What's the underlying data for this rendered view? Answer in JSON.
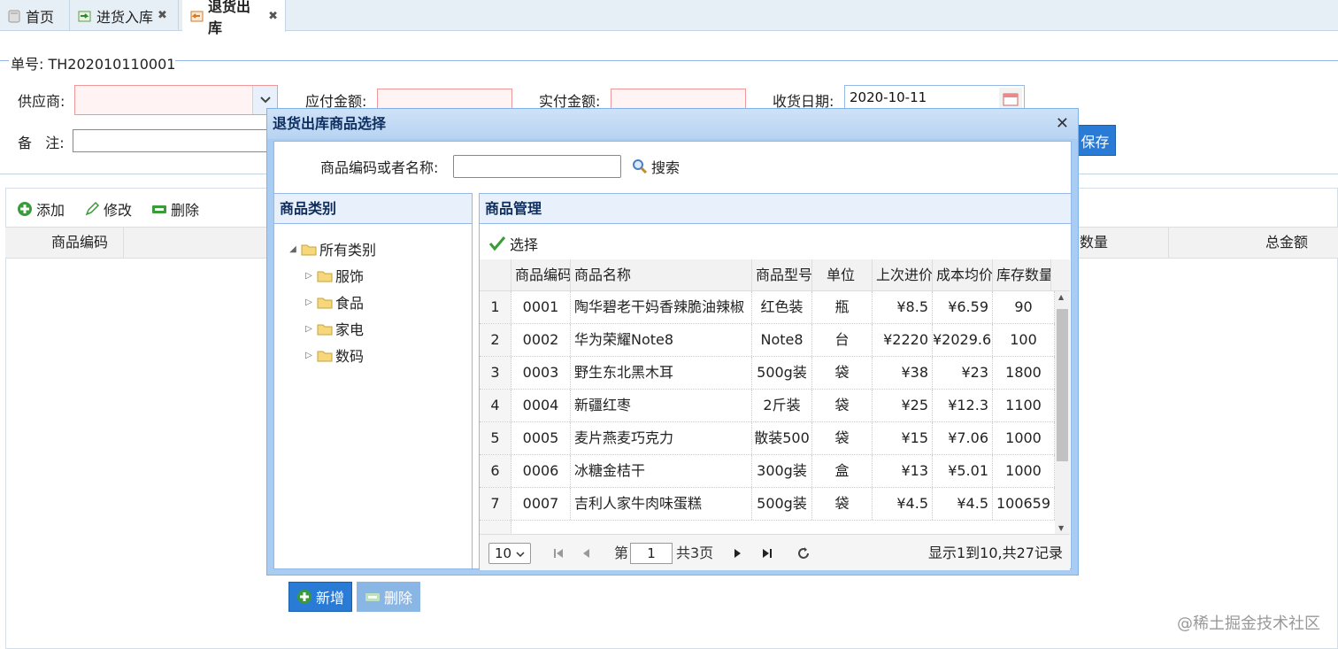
{
  "tabs": [
    {
      "label": "首页",
      "icon": "home-page-icon"
    },
    {
      "label": "进货入库",
      "icon": "stock-in-icon"
    },
    {
      "label": "退货出库",
      "icon": "return-out-icon"
    }
  ],
  "form": {
    "order_no": "单号: TH202010110001",
    "supplier_label": "供应商:",
    "payable_label": "应付金额:",
    "paid_label": "实付金额:",
    "date_label": "收货日期:",
    "date_value": "2020-10-11",
    "remark_label": "备   注:",
    "save_label": "保存"
  },
  "toolbar": {
    "add": "添加",
    "edit": "修改",
    "delete": "删除"
  },
  "grid_columns": {
    "code": "商品编码",
    "qty": "数量",
    "total": "总金额"
  },
  "dialog": {
    "title": "退货出库商品选择",
    "search_label": "商品编码或者名称:",
    "search_value": "",
    "search_button": "搜索",
    "category_panel_title": "商品类别",
    "tree_root": "所有类别",
    "tree_children": [
      "服饰",
      "食品",
      "家电",
      "数码"
    ],
    "new_button": "新增",
    "delete_button": "删除",
    "product_panel_title": "商品管理",
    "select_button": "选择",
    "columns": [
      "商品编码",
      "商品名称",
      "商品型号",
      "单位",
      "上次进价",
      "成本均价",
      "库存数量"
    ],
    "rows": [
      {
        "n": "1",
        "code": "0001",
        "name": "陶华碧老干妈香辣脆油辣椒",
        "model": "红色装",
        "unit": "瓶",
        "last": "¥8.5",
        "avg": "¥6.59",
        "stock": "90"
      },
      {
        "n": "2",
        "code": "0002",
        "name": "华为荣耀Note8",
        "model": "Note8",
        "unit": "台",
        "last": "¥2220",
        "avg": "¥2029.6",
        "stock": "100"
      },
      {
        "n": "3",
        "code": "0003",
        "name": "野生东北黑木耳",
        "model": "500g装",
        "unit": "袋",
        "last": "¥38",
        "avg": "¥23",
        "stock": "1800"
      },
      {
        "n": "4",
        "code": "0004",
        "name": "新疆红枣",
        "model": "2斤装",
        "unit": "袋",
        "last": "¥25",
        "avg": "¥12.3",
        "stock": "1100"
      },
      {
        "n": "5",
        "code": "0005",
        "name": "麦片燕麦巧克力",
        "model": "散装500",
        "unit": "袋",
        "last": "¥15",
        "avg": "¥7.06",
        "stock": "1000"
      },
      {
        "n": "6",
        "code": "0006",
        "name": "冰糖金桔干",
        "model": "300g装",
        "unit": "盒",
        "last": "¥13",
        "avg": "¥5.01",
        "stock": "1000"
      },
      {
        "n": "7",
        "code": "0007",
        "name": "吉利人家牛肉味蛋糕",
        "model": "500g装",
        "unit": "袋",
        "last": "¥4.5",
        "avg": "¥4.5",
        "stock": "100659"
      }
    ],
    "pager": {
      "page_size": "10",
      "page_prefix": "第",
      "page_current": "1",
      "page_suffix": "共3页",
      "info": "显示1到10,共27记录"
    }
  },
  "watermark": "@稀土掘金技术社区",
  "colors": {
    "accent": "#2a7bd5",
    "dialog_border": "#a8ccf2",
    "panel_header": "#e7f0fb"
  }
}
